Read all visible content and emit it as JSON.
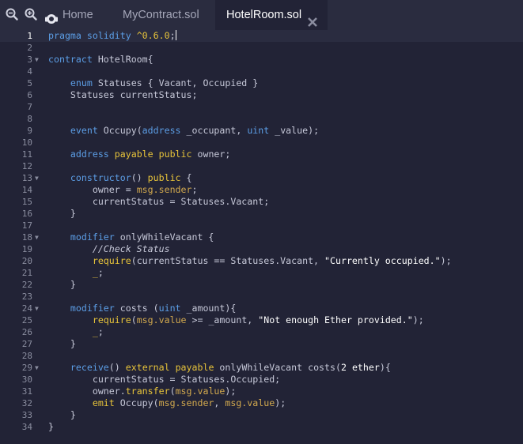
{
  "toolbar": {
    "zoom_out_icon": "zoom-out-icon",
    "zoom_in_icon": "zoom-in-icon",
    "home_icon": "home-icon"
  },
  "tabs": [
    {
      "label": "Home",
      "active": false
    },
    {
      "label": "MyContract.sol",
      "active": false
    },
    {
      "label": "HotelRoom.sol",
      "active": true,
      "closable": true
    }
  ],
  "editor": {
    "active_line": 1,
    "folds": [
      3,
      13,
      18,
      24,
      29
    ],
    "lines": [
      {
        "n": "1",
        "segs": [
          [
            "kw",
            "pragma solidity "
          ],
          [
            "kwy",
            "^0.6.0"
          ],
          [
            "pl",
            ";"
          ]
        ]
      },
      {
        "n": "2",
        "segs": []
      },
      {
        "n": "3",
        "segs": [
          [
            "kw",
            "contract"
          ],
          [
            "pl",
            " HotelRoom{"
          ]
        ]
      },
      {
        "n": "4",
        "segs": []
      },
      {
        "n": "5",
        "segs": [
          [
            "pl",
            "    "
          ],
          [
            "kw",
            "enum"
          ],
          [
            "pl",
            " Statuses { Vacant, Occupied }"
          ]
        ]
      },
      {
        "n": "6",
        "segs": [
          [
            "pl",
            "    Statuses currentStatus;"
          ]
        ]
      },
      {
        "n": "7",
        "segs": []
      },
      {
        "n": "8",
        "segs": []
      },
      {
        "n": "9",
        "segs": [
          [
            "pl",
            "    "
          ],
          [
            "kw",
            "event"
          ],
          [
            "pl",
            " Occupy("
          ],
          [
            "kw",
            "address"
          ],
          [
            "pl",
            " _occupant, "
          ],
          [
            "kw",
            "uint"
          ],
          [
            "pl",
            " _value);"
          ]
        ]
      },
      {
        "n": "10",
        "segs": []
      },
      {
        "n": "11",
        "segs": [
          [
            "pl",
            "    "
          ],
          [
            "kw",
            "address"
          ],
          [
            "pl",
            " "
          ],
          [
            "kwy",
            "payable public"
          ],
          [
            "pl",
            " owner;"
          ]
        ]
      },
      {
        "n": "12",
        "segs": []
      },
      {
        "n": "13",
        "segs": [
          [
            "pl",
            "    "
          ],
          [
            "kw",
            "constructor"
          ],
          [
            "pl",
            "() "
          ],
          [
            "kwy",
            "public"
          ],
          [
            "pl",
            " {"
          ]
        ]
      },
      {
        "n": "14",
        "segs": [
          [
            "pl",
            "        owner = "
          ],
          [
            "ctx",
            "msg.sender"
          ],
          [
            "pl",
            ";"
          ]
        ]
      },
      {
        "n": "15",
        "segs": [
          [
            "pl",
            "        currentStatus = Statuses.Vacant;"
          ]
        ]
      },
      {
        "n": "16",
        "segs": [
          [
            "pl",
            "    }"
          ]
        ]
      },
      {
        "n": "17",
        "segs": []
      },
      {
        "n": "18",
        "segs": [
          [
            "pl",
            "    "
          ],
          [
            "kw",
            "modifier"
          ],
          [
            "pl",
            " onlyWhileVacant {"
          ]
        ]
      },
      {
        "n": "19",
        "segs": [
          [
            "pl",
            "        "
          ],
          [
            "cmt",
            "//Check Status"
          ]
        ]
      },
      {
        "n": "20",
        "segs": [
          [
            "pl",
            "        "
          ],
          [
            "kwy",
            "require"
          ],
          [
            "pl",
            "(currentStatus == Statuses.Vacant, "
          ],
          [
            "str",
            "\"Currently occupied.\""
          ],
          [
            "pl",
            ");"
          ]
        ]
      },
      {
        "n": "21",
        "segs": [
          [
            "pl",
            "        "
          ],
          [
            "kwy",
            "_"
          ],
          [
            "pl",
            ";"
          ]
        ]
      },
      {
        "n": "22",
        "segs": [
          [
            "pl",
            "    }"
          ]
        ]
      },
      {
        "n": "23",
        "segs": []
      },
      {
        "n": "24",
        "segs": [
          [
            "pl",
            "    "
          ],
          [
            "kw",
            "modifier"
          ],
          [
            "pl",
            " costs ("
          ],
          [
            "kw",
            "uint"
          ],
          [
            "pl",
            " _amount){"
          ]
        ]
      },
      {
        "n": "25",
        "segs": [
          [
            "pl",
            "        "
          ],
          [
            "kwy",
            "require"
          ],
          [
            "pl",
            "("
          ],
          [
            "ctx",
            "msg.value"
          ],
          [
            "pl",
            " >= _amount, "
          ],
          [
            "str",
            "\"Not enough Ether provided.\""
          ],
          [
            "pl",
            ");"
          ]
        ]
      },
      {
        "n": "26",
        "segs": [
          [
            "pl",
            "        "
          ],
          [
            "kwy",
            "_"
          ],
          [
            "pl",
            ";"
          ]
        ]
      },
      {
        "n": "27",
        "segs": [
          [
            "pl",
            "    }"
          ]
        ]
      },
      {
        "n": "28",
        "segs": []
      },
      {
        "n": "29",
        "segs": [
          [
            "pl",
            "    "
          ],
          [
            "kw",
            "receive"
          ],
          [
            "pl",
            "() "
          ],
          [
            "kwy",
            "external payable"
          ],
          [
            "pl",
            " onlyWhileVacant costs("
          ],
          [
            "str",
            "2 ether"
          ],
          [
            "pl",
            "){"
          ]
        ]
      },
      {
        "n": "30",
        "segs": [
          [
            "pl",
            "        currentStatus = Statuses.Occupied;"
          ]
        ]
      },
      {
        "n": "31",
        "segs": [
          [
            "pl",
            "        owner."
          ],
          [
            "kwy",
            "transfer"
          ],
          [
            "pl",
            "("
          ],
          [
            "ctx",
            "msg.value"
          ],
          [
            "pl",
            ");"
          ]
        ]
      },
      {
        "n": "32",
        "segs": [
          [
            "pl",
            "        "
          ],
          [
            "kwy",
            "emit"
          ],
          [
            "pl",
            " Occupy("
          ],
          [
            "ctx",
            "msg.sender"
          ],
          [
            "pl",
            ", "
          ],
          [
            "ctx",
            "msg.value"
          ],
          [
            "pl",
            ");"
          ]
        ]
      },
      {
        "n": "33",
        "segs": [
          [
            "pl",
            "    }"
          ]
        ]
      },
      {
        "n": "34",
        "segs": [
          [
            "pl",
            "}"
          ]
        ]
      }
    ]
  },
  "colors": {
    "background": "#222336",
    "tabbar": "#2a2c3f",
    "keyword": "#5c9ee6",
    "keyword_yellow": "#e8c43a",
    "text": "#c6c8d8",
    "string": "#ffffff"
  }
}
